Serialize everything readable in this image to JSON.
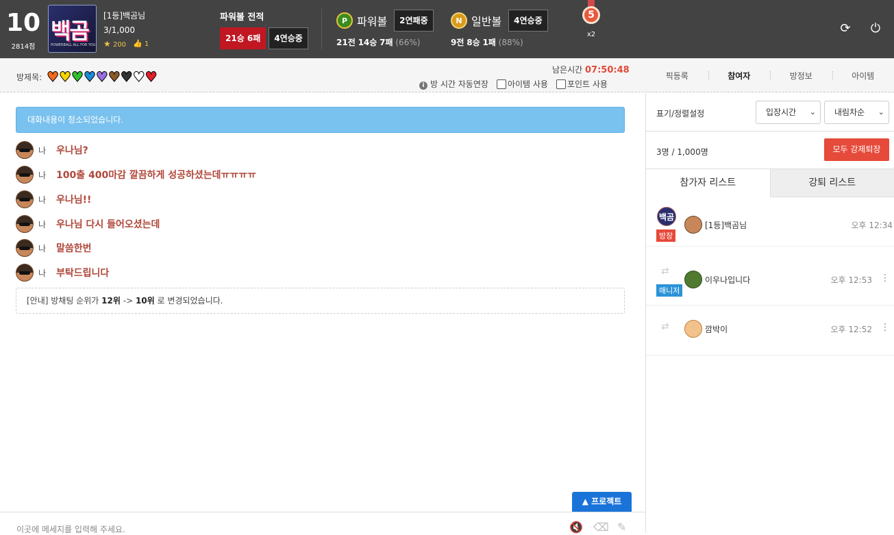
{
  "header": {
    "rank_number": "10",
    "rank_points": "2814점",
    "logo_text": "백곰",
    "logo_sub": "POWERBALL ALL FOR YOU",
    "user_name": "[1등]백곰님",
    "user_count": "3/1,000",
    "stars": "200",
    "likes": "1",
    "pb_record_title": "파워볼 전적",
    "pb_record_winloss": "21승 6패",
    "pb_record_streak": "4연승중",
    "powerball": {
      "coin": "P",
      "label": "파워볼",
      "streak": "2연패중",
      "games": "21전",
      "wins": "14승",
      "losses": "7패",
      "pct": "(66%)"
    },
    "normalball": {
      "coin": "N",
      "label": "일반볼",
      "streak": "4연승중",
      "games": "9전",
      "wins": "8승",
      "losses": "1패",
      "pct": "(88%)"
    },
    "medal_number": "5",
    "medal_multiplier": "x2",
    "refresh_icon": "refresh-icon",
    "power_icon": "power-icon"
  },
  "subbar": {
    "color_label": "방제목:",
    "hearts": [
      "#f26a1b",
      "#f5d400",
      "#2fbf2f",
      "#1e8bd8",
      "#9a6fe0",
      "#8b5a2b",
      "#333333",
      "#ffffff",
      "#e21f2a"
    ],
    "remaining_label": "남은시간",
    "remaining_time": "07:50:48",
    "auto_extend": "방 시간 자동연장",
    "item_use": "아이템 사용",
    "point_use": "포인트 사용",
    "tabs": [
      "픽등록",
      "참여자",
      "방정보",
      "아이템"
    ],
    "active_tab": "참여자"
  },
  "chat": {
    "cleared_notice": "대화내용이 청소되었습니다.",
    "messages": [
      {
        "who": "나",
        "text": "우나님?"
      },
      {
        "who": "나",
        "text": "100출 400마감 깔끔하게 성공하셨는데ㅠㅠㅠㅠ"
      },
      {
        "who": "나",
        "text": "우나님!!"
      },
      {
        "who": "나",
        "text": "우나님 다시 들어오셨는데"
      },
      {
        "who": "나",
        "text": "말씀한번"
      },
      {
        "who": "나",
        "text": "부탁드립니다"
      }
    ],
    "rank_notice_prefix": "[안내] 방채팅 순위가",
    "rank_from": "12위",
    "rank_arrow": "->",
    "rank_to": "10위",
    "rank_notice_suffix": "로 변경되었습니다.",
    "project_button": "프로젝트",
    "input_placeholder": "이곳에 메세지를 입력해 주세요."
  },
  "panel": {
    "sort_label": "표기/정렬설정",
    "sort_field": "입장시간",
    "sort_order": "내림차순",
    "count_text": "3명 / 1,000명",
    "kick_all_button": "모두 강제퇴장",
    "tabs": [
      "참가자 리스트",
      "강퇴 리스트"
    ],
    "members": [
      {
        "badge": "방장",
        "badge_color": "#e64a3a",
        "name": "[1등]백곰님",
        "time": "오후 12:34"
      },
      {
        "badge": "매니저",
        "badge_color": "#2c93d8",
        "name": "이우나입니다",
        "time": "오후 12:53"
      },
      {
        "badge": "",
        "name": "깜박이",
        "time": "오후 12:52"
      }
    ]
  }
}
